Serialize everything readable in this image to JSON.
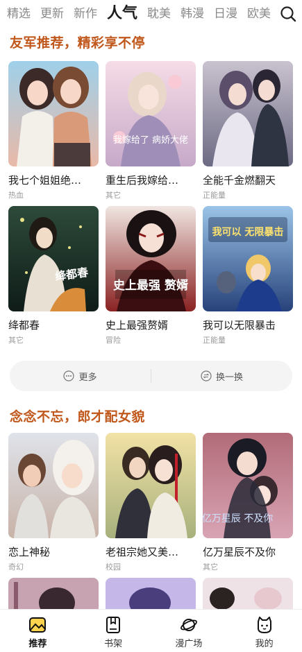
{
  "tabs": [
    "精选",
    "更新",
    "新作",
    "人气",
    "耽美",
    "韩漫",
    "日漫",
    "欧美"
  ],
  "active_tab": "人气",
  "sections": [
    {
      "title": "友军推荐，精彩享不停",
      "items": [
        {
          "title": "我七个姐姐绝…",
          "tag": "热血"
        },
        {
          "title": "重生后我嫁给…",
          "tag": "其它",
          "cover_text": "我嫁给了 病娇大佬"
        },
        {
          "title": "全能千金燃翻天",
          "tag": "正能量"
        },
        {
          "title": "绛都春",
          "tag": "其它",
          "cover_text": "绛都春"
        },
        {
          "title": "史上最强赘婿",
          "tag": "冒险",
          "cover_text": "史上最强 赘婿"
        },
        {
          "title": "我可以无限暴击",
          "tag": "正能量",
          "cover_text": "我可以 无限暴击"
        }
      ]
    },
    {
      "title": "念念不忘，郎才配女貌",
      "items": [
        {
          "title": "恋上神秘",
          "tag": "奇幻"
        },
        {
          "title": "老祖宗她又美…",
          "tag": "校园"
        },
        {
          "title": "亿万星辰不及你",
          "tag": "其它",
          "cover_text": "亿万星辰 不及你"
        }
      ]
    }
  ],
  "actions": {
    "more": "更多",
    "refresh": "换一换"
  },
  "bottom_nav": [
    {
      "label": "推荐",
      "icon": "recommend-icon",
      "active": true
    },
    {
      "label": "书架",
      "icon": "bookshelf-icon",
      "active": false
    },
    {
      "label": "漫广场",
      "icon": "planet-icon",
      "active": false
    },
    {
      "label": "我的",
      "icon": "profile-cat-icon",
      "active": false
    }
  ],
  "colors": {
    "accent": "#c0571b",
    "tab_inactive": "#8a8a8a",
    "text": "#1d1d1d",
    "subtext": "#9a9a9a"
  }
}
